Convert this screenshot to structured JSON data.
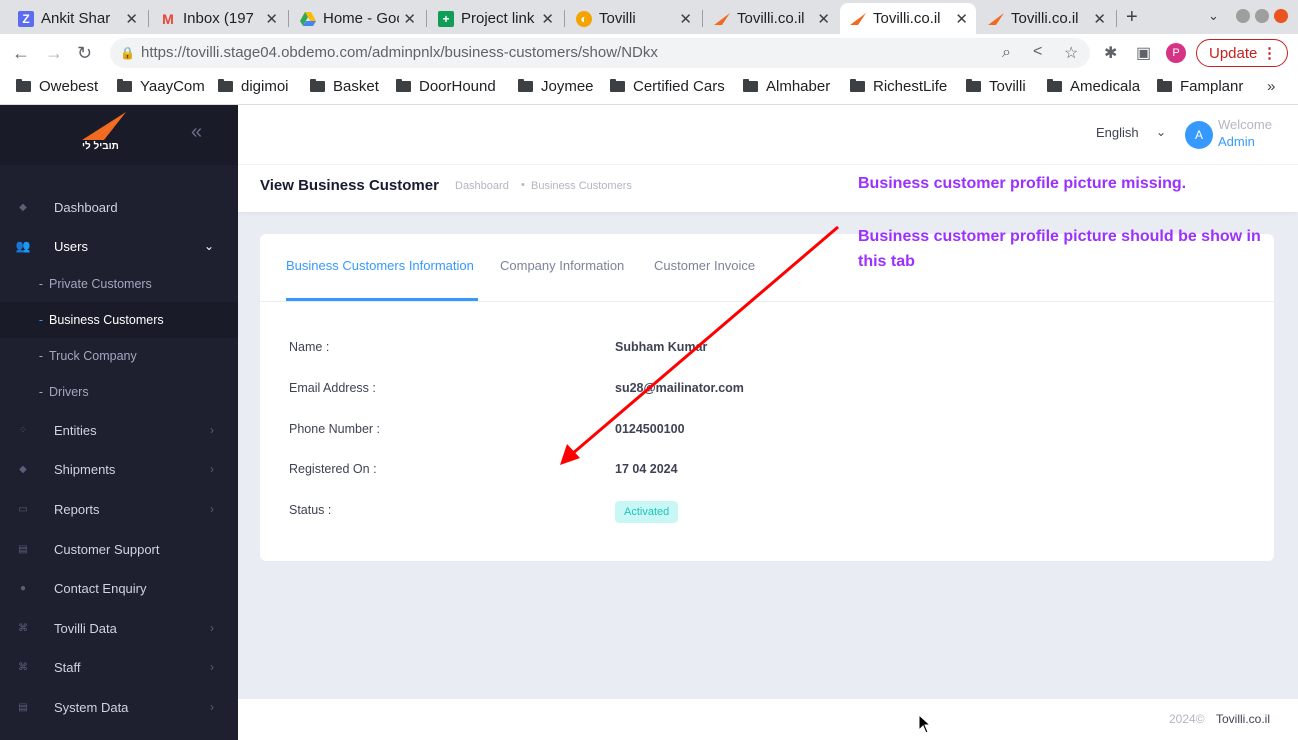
{
  "browser": {
    "tabs": [
      {
        "title": "Ankit Shar",
        "favicon": "z-icon"
      },
      {
        "title": "Inbox (197",
        "favicon": "gmail-icon"
      },
      {
        "title": "Home - Goo",
        "favicon": "drive-icon"
      },
      {
        "title": "Project link",
        "favicon": "sheets-icon"
      },
      {
        "title": "Tovilli",
        "favicon": "tovilli-icon"
      },
      {
        "title": "Tovilli.co.il",
        "favicon": "tovilli-logo-icon"
      },
      {
        "title": "Tovilli.co.il",
        "favicon": "tovilli-logo-icon"
      },
      {
        "title": "Tovilli.co.il",
        "favicon": "tovilli-logo-icon"
      }
    ],
    "active_tab": 6,
    "url": "https://tovilli.stage04.obdemo.com/adminpnlx/business-customers/show/NDkx",
    "update_label": "Update",
    "bookmarks": [
      "Owebest",
      "YaayCom",
      "digimoi",
      "Basket",
      "DoorHound",
      "Joymee",
      "Certified Cars",
      "Almhaber",
      "RichestLife",
      "Tovilli",
      "Amedicala",
      "Famplanr"
    ],
    "bookmarks_more": "»"
  },
  "sidebar": {
    "logo_text": "תוביל לי",
    "menu": [
      {
        "label": "Dashboard",
        "icon": "diamond-icon",
        "caret": false
      },
      {
        "label": "Users",
        "icon": "users-icon",
        "caret": true,
        "open": true
      },
      {
        "label": "Entities",
        "icon": "entities-icon",
        "caret": true
      },
      {
        "label": "Shipments",
        "icon": "diamond-icon",
        "caret": true
      },
      {
        "label": "Reports",
        "icon": "reports-icon",
        "caret": true
      },
      {
        "label": "Customer Support",
        "icon": "support-icon",
        "caret": false
      },
      {
        "label": "Contact Enquiry",
        "icon": "enquiry-icon",
        "caret": false
      },
      {
        "label": "Tovilli Data",
        "icon": "command-icon",
        "caret": true
      },
      {
        "label": "Staff",
        "icon": "command-icon",
        "caret": true
      },
      {
        "label": "System Data",
        "icon": "system-icon",
        "caret": true
      }
    ],
    "users_submenu": [
      "Private Customers",
      "Business Customers",
      "Truck Company",
      "Drivers"
    ],
    "active_submenu": "Business Customers"
  },
  "topbar": {
    "language": "English",
    "avatar_letter": "A",
    "welcome": "Welcome",
    "user": "Admin"
  },
  "subheader": {
    "title": "View Business Customer",
    "breadcrumb": [
      "Dashboard",
      "Business Customers"
    ]
  },
  "card": {
    "tabs": [
      "Business Customers Information",
      "Company Information",
      "Customer Invoice"
    ],
    "active_tab": 0,
    "rows": [
      {
        "label": "Name :",
        "value": "Subham Kumar"
      },
      {
        "label": "Email Address :",
        "value": "su28@mailinator.com"
      },
      {
        "label": "Phone Number :",
        "value": "0124500100"
      },
      {
        "label": "Registered On :",
        "value": "17 04 2024"
      },
      {
        "label": "Status :",
        "value": "Activated"
      }
    ]
  },
  "footer": {
    "year": "2024©",
    "brand": "Tovilli.co.il"
  },
  "annotations": {
    "line1": "Business customer profile picture missing.",
    "line2": "Business customer profile picture should be show in this tab"
  },
  "colors": {
    "accent": "#3699ff",
    "sidebar_bg": "#1e1f2f",
    "annotation": "#9b30ff",
    "arrow": "#ff0000",
    "status_bg": "#c9f7f5",
    "status_text": "#1bc5bd"
  }
}
